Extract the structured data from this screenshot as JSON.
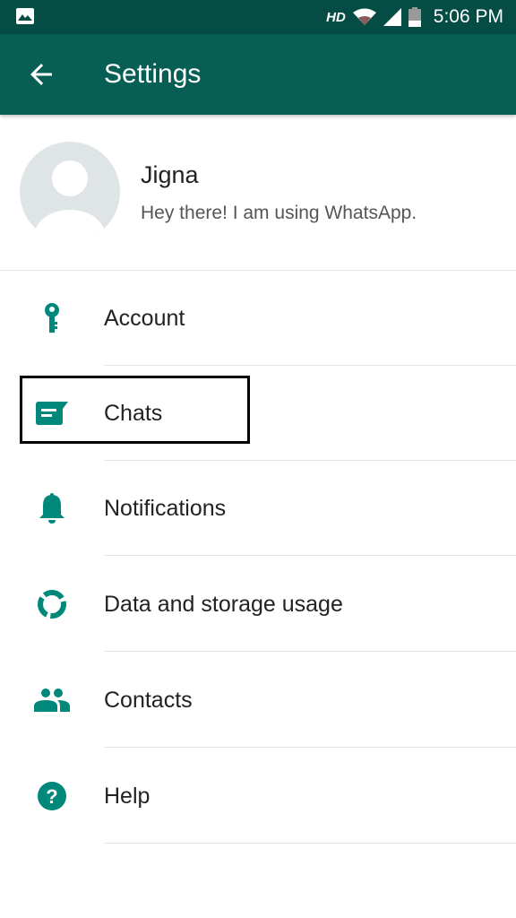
{
  "status_bar": {
    "network_label": "HD",
    "time": "5:06 PM",
    "icons": [
      "gallery-icon",
      "wifi-icon",
      "signal-icon",
      "battery-icon"
    ]
  },
  "app_bar": {
    "back_icon": "arrow-left-icon",
    "title": "Settings"
  },
  "profile": {
    "name": "Jigna",
    "status": "Hey there! I am using WhatsApp."
  },
  "menu": {
    "items": [
      {
        "label": "Account",
        "icon": "key-icon"
      },
      {
        "label": "Chats",
        "icon": "chat-icon"
      },
      {
        "label": "Notifications",
        "icon": "bell-icon"
      },
      {
        "label": "Data and storage usage",
        "icon": "data-usage-icon"
      },
      {
        "label": "Contacts",
        "icon": "contacts-icon"
      },
      {
        "label": "Help",
        "icon": "help-icon"
      }
    ]
  },
  "colors": {
    "status_bar": "#054d44",
    "app_bar": "#075e54",
    "accent": "#00897b",
    "highlight_border": "#000000"
  }
}
